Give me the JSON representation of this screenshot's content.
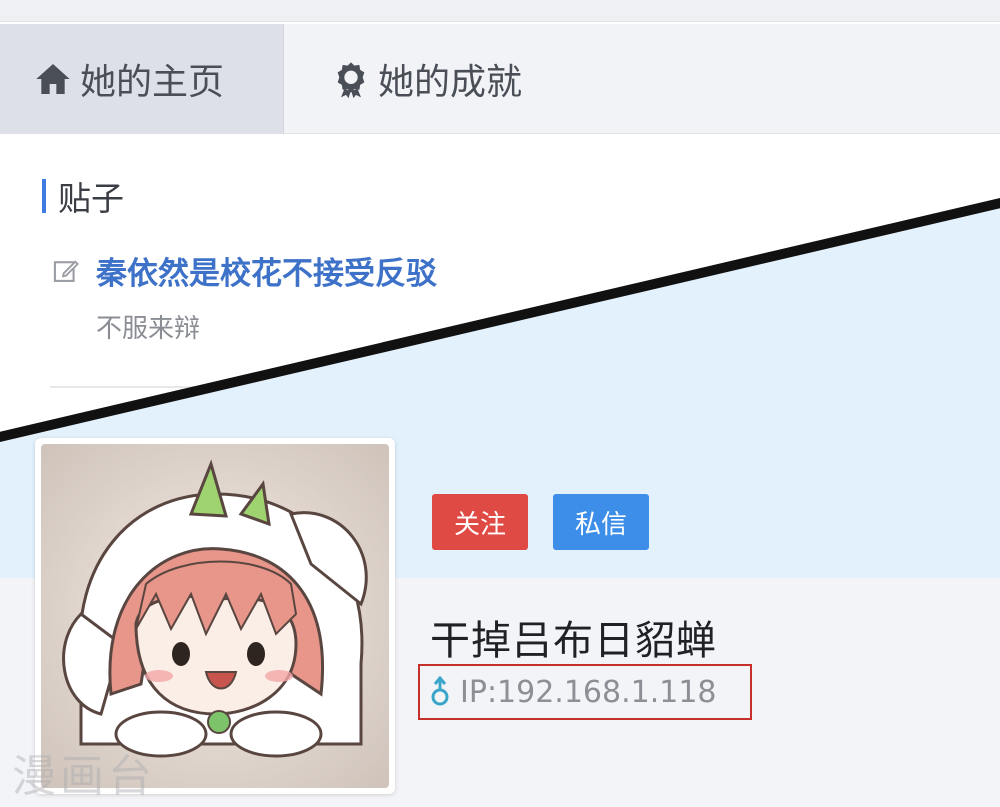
{
  "tabs": [
    {
      "label": "她的主页",
      "icon": "home-icon",
      "active": true
    },
    {
      "label": "她的成就",
      "icon": "award-icon",
      "active": false
    }
  ],
  "posts": {
    "section_title": "贴子",
    "items": [
      {
        "title": "秦依然是校花不接受反驳",
        "excerpt": "不服来辩",
        "icon": "edit-icon"
      }
    ]
  },
  "profile": {
    "follow_label": "关注",
    "message_label": "私信",
    "username": "干掉吕布日貂蝉",
    "ip_text": "IP:192.168.1.118",
    "gender_icon": "male-icon"
  },
  "watermark": "漫画台",
  "colors": {
    "follow": "#e04a44",
    "message": "#3d8ee8",
    "link": "#3e72c8",
    "highlight_box": "#c6302b",
    "banner": "#e3f1fc"
  }
}
